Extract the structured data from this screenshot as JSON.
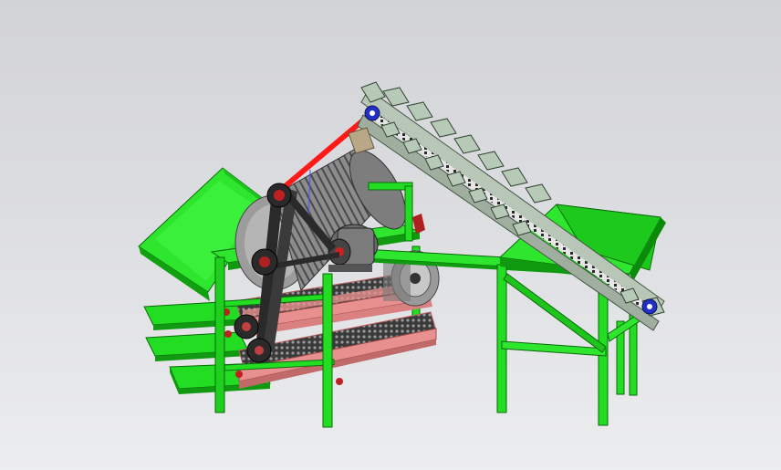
{
  "scene": {
    "subject": "cad-3d-model-render",
    "colors": {
      "frame_green": "#22dd22",
      "frame_green_dark": "#0f9a0f",
      "hopper_green": "#2ee62e",
      "screen_pink": "#e89090",
      "mesh_dark": "#2a2a2a",
      "drum_gray": "#8f8f8f",
      "shaft_red": "#ff1a1a",
      "bearing_blue": "#2030c0",
      "conveyor_gray": "#9aa89a",
      "pulley_dark": "#222222",
      "motor_gray": "#6a6a6a"
    }
  }
}
